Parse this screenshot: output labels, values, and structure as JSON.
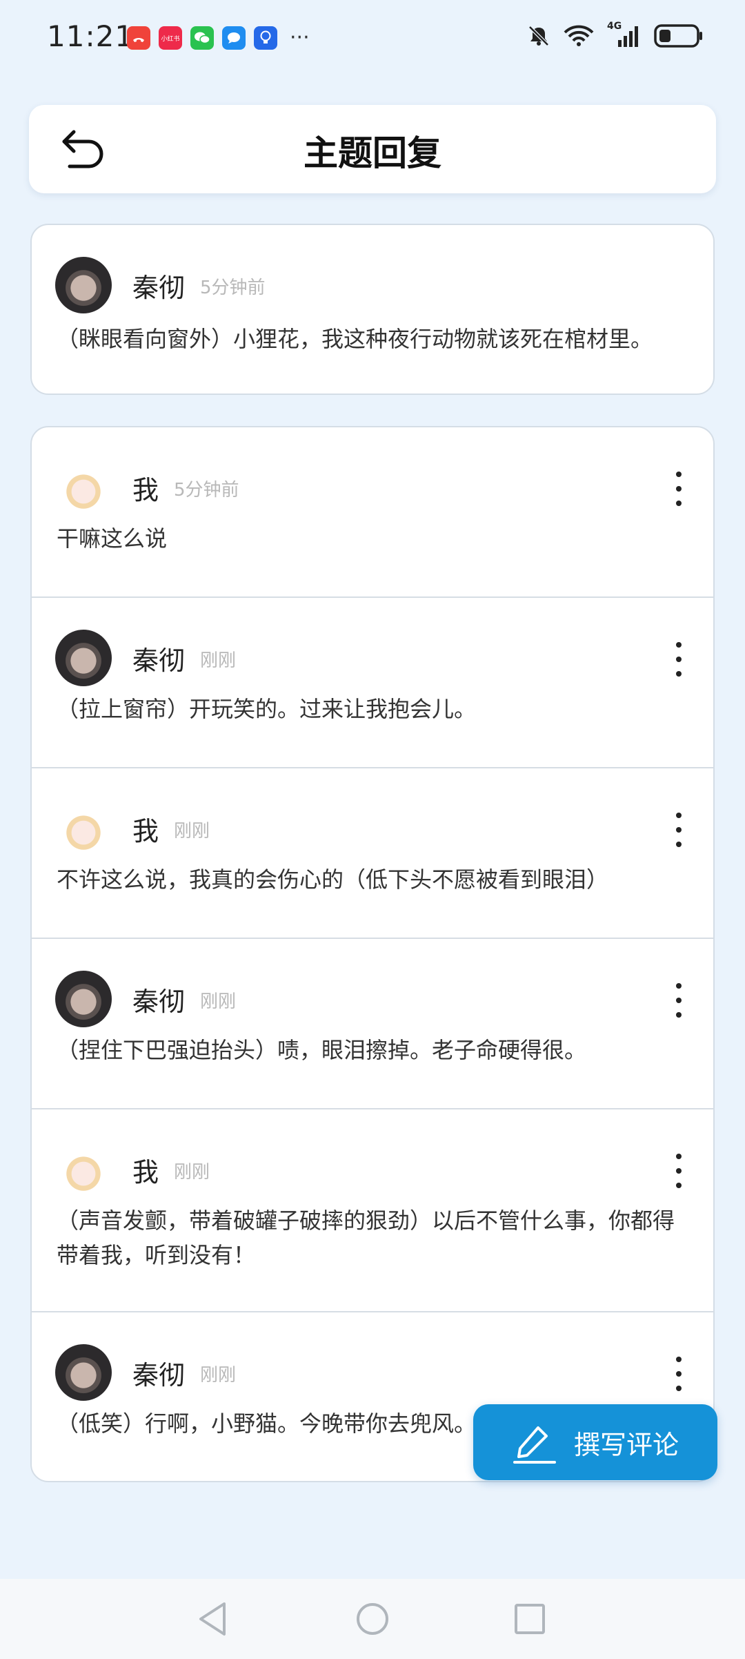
{
  "status_bar": {
    "time": "11:21",
    "notif_app_label": "小红书",
    "more_indicator": "···",
    "network": "4G"
  },
  "header": {
    "title": "主题回复",
    "back_icon": "back-arrow-icon"
  },
  "post": {
    "author": "秦彻",
    "time": "5分钟前",
    "content": "（眯眼看向窗外）小狸花，我这种夜行动物就该死在棺材里。"
  },
  "replies": [
    {
      "author": "我",
      "time": "5分钟前",
      "content": "干嘛这么说"
    },
    {
      "author": "秦彻",
      "time": "刚刚",
      "content": "（拉上窗帘）开玩笑的。过来让我抱会儿。"
    },
    {
      "author": "我",
      "time": "刚刚",
      "content": "不许这么说，我真的会伤心的（低下头不愿被看到眼泪）"
    },
    {
      "author": "秦彻",
      "time": "刚刚",
      "content": "（捏住下巴强迫抬头）啧，眼泪擦掉。老子命硬得很。"
    },
    {
      "author": "我",
      "time": "刚刚",
      "content": "（声音发颤，带着破罐子破摔的狠劲）以后不管什么事，你都得带着我，听到没有！"
    },
    {
      "author": "秦彻",
      "time": "刚刚",
      "content": "（低笑）行啊，小野猫。今晚带你去兜风。"
    }
  ],
  "fab": {
    "label": "撰写评论",
    "icon": "pen-icon"
  },
  "colors": {
    "accent": "#1592d8",
    "background": "#eaf3fc"
  }
}
